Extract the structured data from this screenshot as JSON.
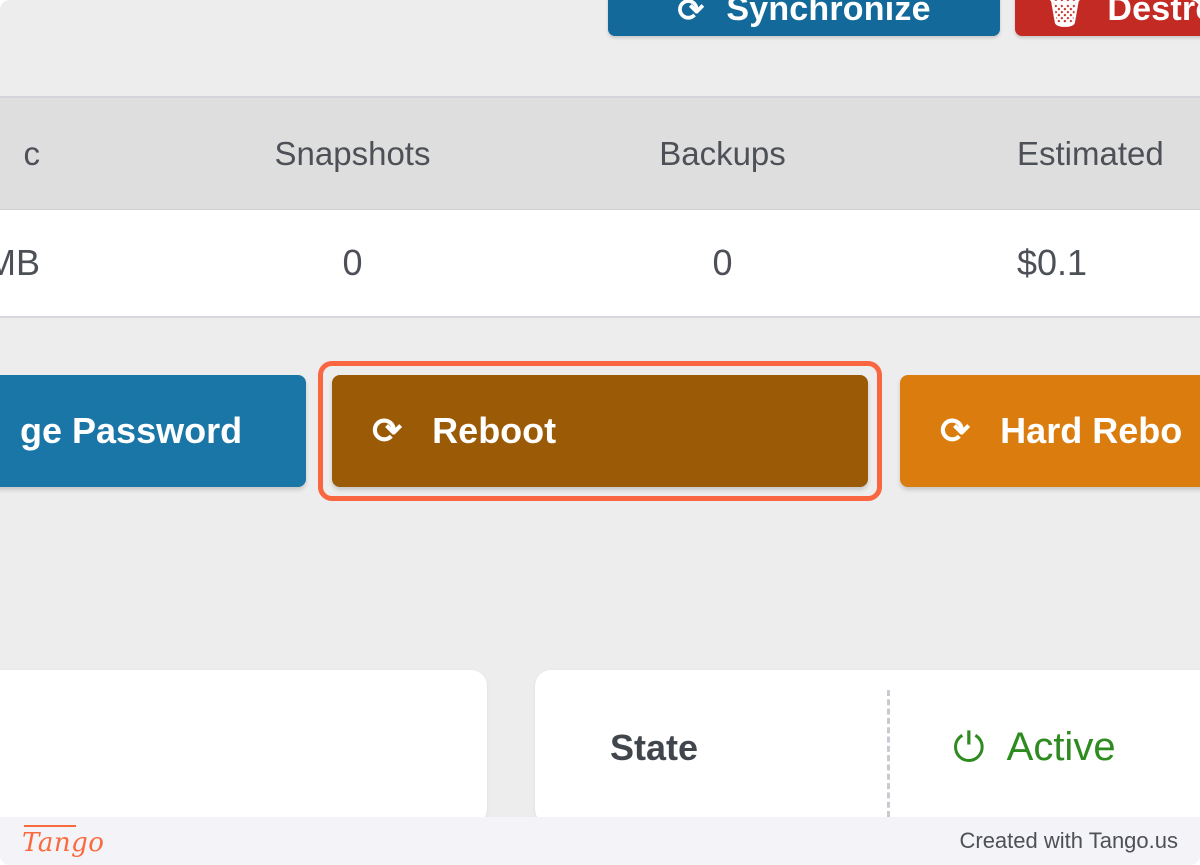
{
  "top_actions": [
    {
      "id": "synchronize",
      "label": "Synchronize",
      "icon": "refresh-icon",
      "color": "#136a9a"
    },
    {
      "id": "destroy",
      "label": "Destroy",
      "icon": "trash-icon",
      "color": "#c32a24"
    }
  ],
  "table": {
    "headers": [
      "c",
      "Snapshots",
      "Backups",
      "Estimated"
    ],
    "row": [
      "MB",
      "0",
      "0",
      "$0.1"
    ]
  },
  "controls": [
    {
      "id": "change-password",
      "label": "ge Password",
      "icon": "key-icon",
      "color": "#1b76a8"
    },
    {
      "id": "reboot",
      "label": "Reboot",
      "icon": "refresh-icon",
      "color": "#9b5a06",
      "highlighted": true
    },
    {
      "id": "hard-reboot",
      "label": "Hard Rebo",
      "icon": "refresh-icon",
      "color": "#da7d0e"
    }
  ],
  "highlight_color": "#f9663f",
  "cards": {
    "left": {},
    "right": {
      "label": "State",
      "value": "Active",
      "value_icon": "power-icon",
      "value_color": "#2e8b1f"
    }
  },
  "footer": {
    "logo": "Tango",
    "note": "Created with Tango.us",
    "logo_color": "#f96b3f"
  }
}
